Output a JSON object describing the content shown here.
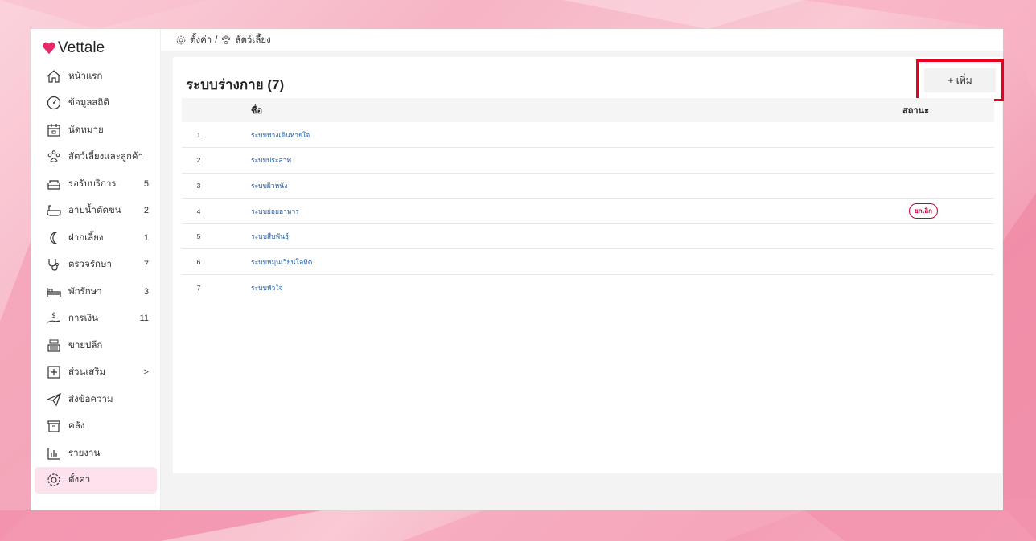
{
  "app": {
    "name": "Vettale"
  },
  "breadcrumb": {
    "settings": "ตั้งค่า",
    "separator": "/",
    "pets": "สัตว์เลี้ยง"
  },
  "sidebar": {
    "items": [
      {
        "label": "หน้าแรก",
        "icon": "home-icon",
        "count": ""
      },
      {
        "label": "ข้อมูลสถิติ",
        "icon": "dashboard-icon",
        "count": ""
      },
      {
        "label": "นัดหมาย",
        "icon": "calendar-icon",
        "count": ""
      },
      {
        "label": "สัตว์เลี้ยงและลูกค้า",
        "icon": "paw-icon",
        "count": ""
      },
      {
        "label": "รอรับบริการ",
        "icon": "sofa-icon",
        "count": "5"
      },
      {
        "label": "อาบน้ำตัดขน",
        "icon": "bathtub-icon",
        "count": "2"
      },
      {
        "label": "ฝากเลี้ยง",
        "icon": "moon-icon",
        "count": "1"
      },
      {
        "label": "ตรวจรักษา",
        "icon": "stethoscope-icon",
        "count": "7"
      },
      {
        "label": "พักรักษา",
        "icon": "bed-icon",
        "count": "3"
      },
      {
        "label": "การเงิน",
        "icon": "money-hand-icon",
        "count": "11"
      },
      {
        "label": "ขายปลีก",
        "icon": "cash-register-icon",
        "count": ""
      },
      {
        "label": "ส่วนเสริม",
        "icon": "plus-box-icon",
        "count": ">"
      },
      {
        "label": "ส่งข้อความ",
        "icon": "paper-plane-icon",
        "count": ""
      },
      {
        "label": "คลัง",
        "icon": "archive-icon",
        "count": ""
      },
      {
        "label": "รายงาน",
        "icon": "bar-chart-icon",
        "count": ""
      },
      {
        "label": "ตั้งค่า",
        "icon": "gear-icon",
        "count": ""
      }
    ]
  },
  "panel": {
    "title": "ระบบร่างกาย (7)",
    "add_label": "+ เพิ่ม",
    "columns": {
      "number": "",
      "name": "ชื่อ",
      "status": "สถานะ"
    },
    "rows": [
      {
        "num": "1",
        "name": "ระบบทางเดินหายใจ",
        "status": ""
      },
      {
        "num": "2",
        "name": "ระบบประสาท",
        "status": ""
      },
      {
        "num": "3",
        "name": "ระบบผิวหนัง",
        "status": ""
      },
      {
        "num": "4",
        "name": "ระบบย่อยอาหาร",
        "status": "ยกเลิก"
      },
      {
        "num": "5",
        "name": "ระบบสืบพันธุ์",
        "status": ""
      },
      {
        "num": "6",
        "name": "ระบบหมุนเวียนโลหิต",
        "status": ""
      },
      {
        "num": "7",
        "name": "ระบบหัวใจ",
        "status": ""
      }
    ]
  },
  "colors": {
    "accent": "#e8001e",
    "active_bg": "#fde1ec",
    "link": "#1f5fa8",
    "badge": "#c4003a",
    "logo_heart": "#e8286a"
  }
}
